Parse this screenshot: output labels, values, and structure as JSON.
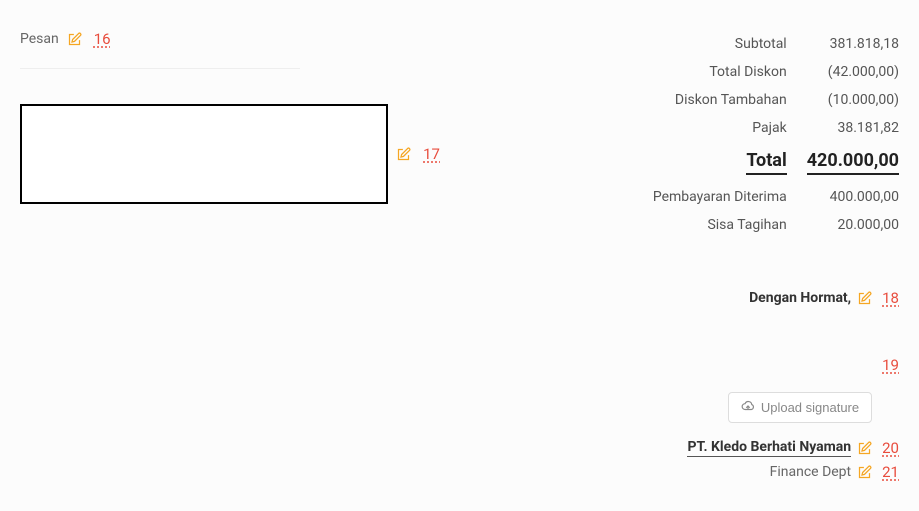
{
  "left": {
    "pesan_label": "Pesan",
    "annot16": "16",
    "annot17": "17"
  },
  "summary": {
    "subtotal_label": "Subtotal",
    "subtotal_value": "381.818,18",
    "discount_label": "Total Diskon",
    "discount_value": "(42.000,00)",
    "extra_discount_label": "Diskon Tambahan",
    "extra_discount_value": "(10.000,00)",
    "tax_label": "Pajak",
    "tax_value": "38.181,82",
    "total_label": "Total",
    "total_value": "420.000,00",
    "paid_label": "Pembayaran Diterima",
    "paid_value": "400.000,00",
    "due_label": "Sisa Tagihan",
    "due_value": "20.000,00"
  },
  "closing": {
    "text": "Dengan Hormat,",
    "annot18": "18"
  },
  "upload": {
    "label": "Upload signature",
    "annot19": "19"
  },
  "company": {
    "name": "PT. Kledo Berhati Nyaman",
    "annot20": "20"
  },
  "dept": {
    "name": "Finance Dept",
    "annot21": "21"
  }
}
